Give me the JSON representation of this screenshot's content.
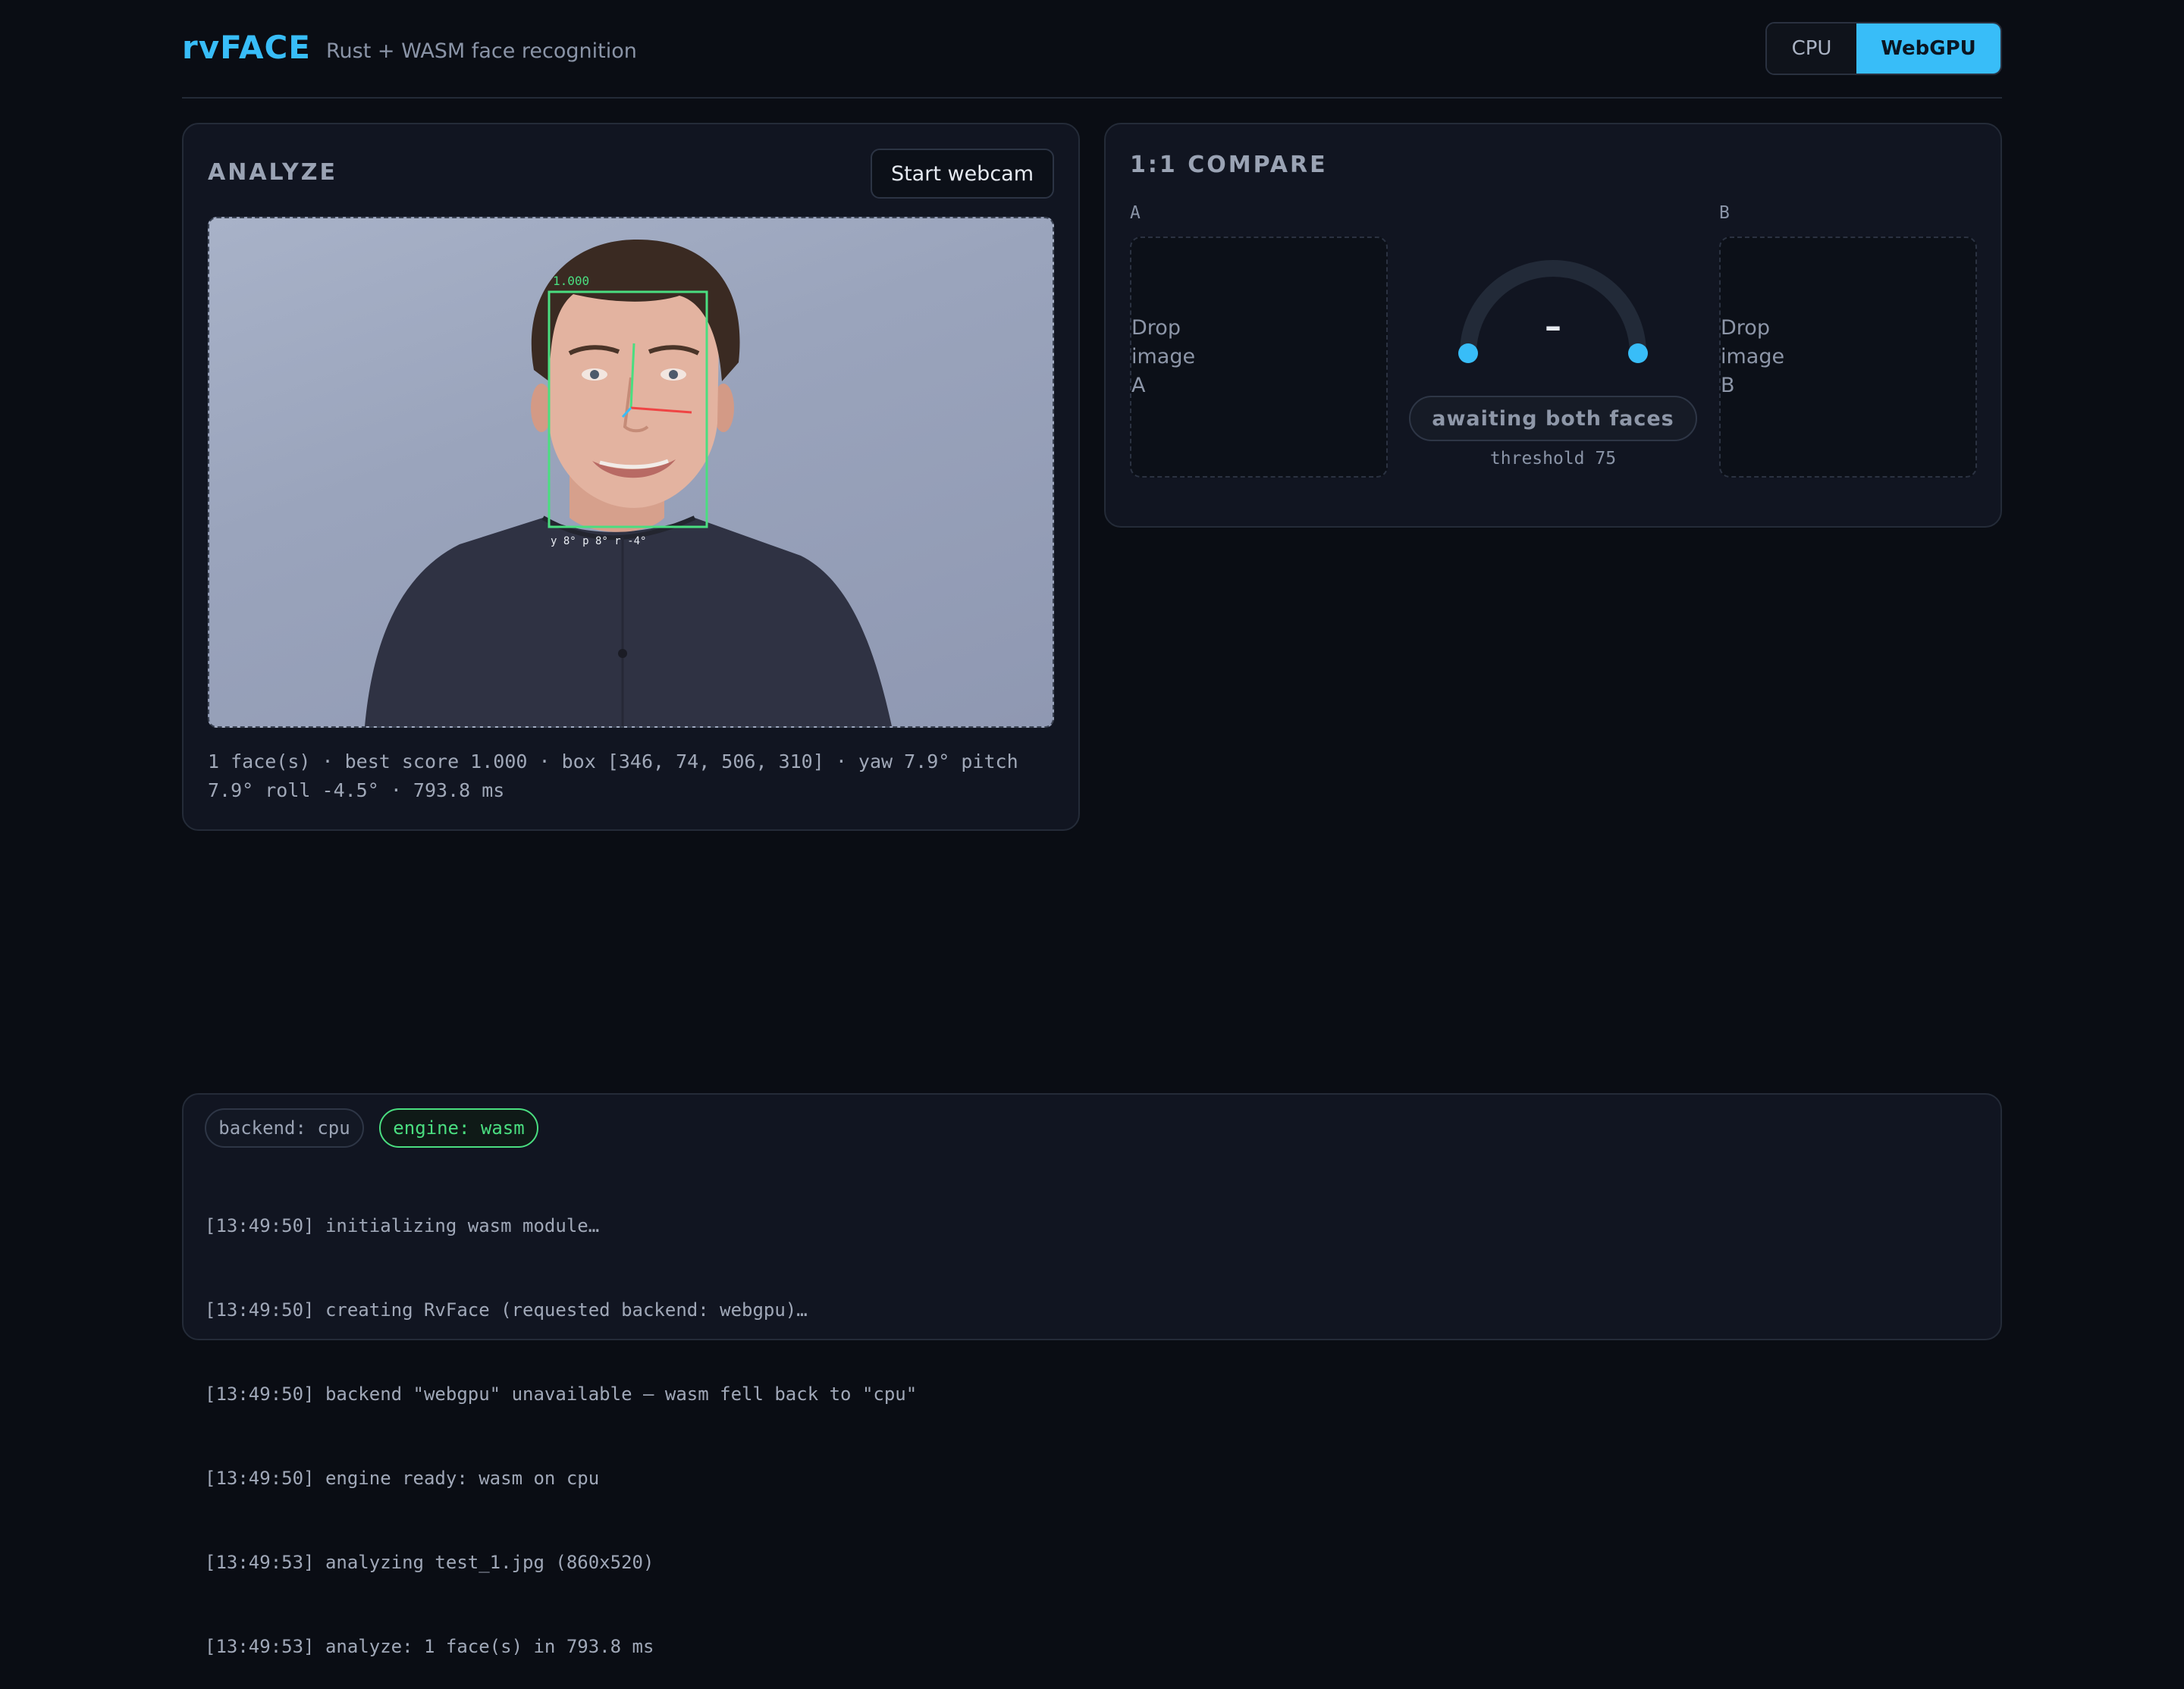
{
  "header": {
    "brand": "rvFACE",
    "subtitle": "Rust + WASM face recognition",
    "backend_toggle": {
      "cpu_label": "CPU",
      "webgpu_label": "WebGPU",
      "selected": "WebGPU"
    }
  },
  "analyze": {
    "title": "ANALYZE",
    "webcam_button": "Start webcam",
    "detection": {
      "score_label": "1.000",
      "pose_label": "y 8°  p 8°  r -4°"
    },
    "result_line1": "1 face(s) · best score 1.000 · box [346, 74, 506, 310] · yaw 7.9° pitch",
    "result_line2": "7.9° roll -4.5° · 793.8 ms"
  },
  "compare": {
    "title": "1:1 COMPARE",
    "slot_a": {
      "label": "A",
      "drop_text": [
        "Drop",
        "image",
        "A"
      ]
    },
    "slot_b": {
      "label": "B",
      "drop_text": [
        "Drop",
        "image",
        "B"
      ]
    },
    "gauge_value": "–",
    "verdict": "awaiting both faces",
    "threshold": "threshold 75"
  },
  "status": {
    "backend_chip": "backend: cpu",
    "engine_chip": "engine: wasm",
    "log": [
      "[13:49:50] initializing wasm module…",
      "[13:49:50] creating RvFace (requested backend: webgpu)…",
      "[13:49:50] backend \"webgpu\" unavailable — wasm fell back to \"cpu\"",
      "[13:49:50] engine ready: wasm on cpu",
      "[13:49:53] analyzing test_1.jpg (860x520)",
      "[13:49:53] analyze: 1 face(s) in 793.8 ms"
    ]
  },
  "colors": {
    "accent": "#38bdf8",
    "success": "#4ade80",
    "background": "#0a0d14",
    "panel": "#111521"
  }
}
